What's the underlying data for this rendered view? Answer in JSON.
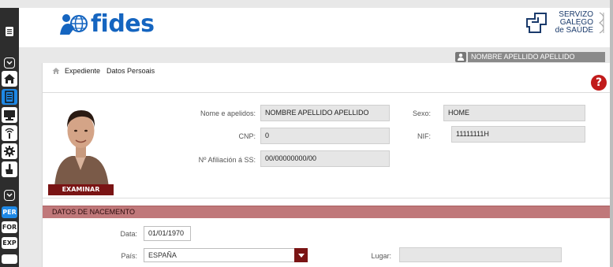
{
  "sidebar": {
    "collapse_icons": [
      "collapse-icon",
      "collapse-icon",
      "collapse-icon"
    ],
    "items": [
      {
        "icon": "menu-icon"
      },
      {
        "icon": "home-icon"
      },
      {
        "icon": "document-icon"
      },
      {
        "icon": "monitor-icon"
      },
      {
        "icon": "signal-icon"
      },
      {
        "icon": "gear-icon"
      },
      {
        "icon": "hand-icon"
      }
    ],
    "text_items": [
      {
        "label": "PER",
        "active": true
      },
      {
        "label": "FOR",
        "active": false
      },
      {
        "label": "EXP",
        "active": false
      }
    ]
  },
  "header": {
    "app_name": "fides",
    "org_line1": "SERVIZO",
    "org_line2": "GALEGO",
    "org_line3": "de SAÚDE"
  },
  "user": {
    "name": "NOMBRE APELLIDO APELLIDO"
  },
  "breadcrumb": {
    "item1": "Expediente",
    "item2": "Datos Persoais"
  },
  "help_label": "?",
  "photo": {
    "button_label": "EXAMINAR"
  },
  "fields": {
    "nome_label": "Nome e apelidos:",
    "nome_value": "NOMBRE APELLIDO APELLIDO",
    "sexo_label": "Sexo:",
    "sexo_value": "HOME",
    "cnp_label": "CNP:",
    "cnp_value": "0",
    "nif_label": "NIF:",
    "nif_value": "11111111H",
    "afil_label": "Nº Afiliación á SS:",
    "afil_value": "00/00000000/00"
  },
  "nacemento": {
    "title": "DATOS DE NACEMENTO",
    "data_label": "Data:",
    "data_value": "01/01/1970",
    "pais_label": "País:",
    "pais_value": "ESPAÑA",
    "lugar_label": "Lugar:",
    "lugar_value": ""
  },
  "colors": {
    "brand_blue": "#1565c0",
    "accent_red": "#7a1414",
    "section_bg": "#c0787a",
    "sidebar_bg": "#2d2d2d",
    "active_blue": "#1e88e5"
  }
}
